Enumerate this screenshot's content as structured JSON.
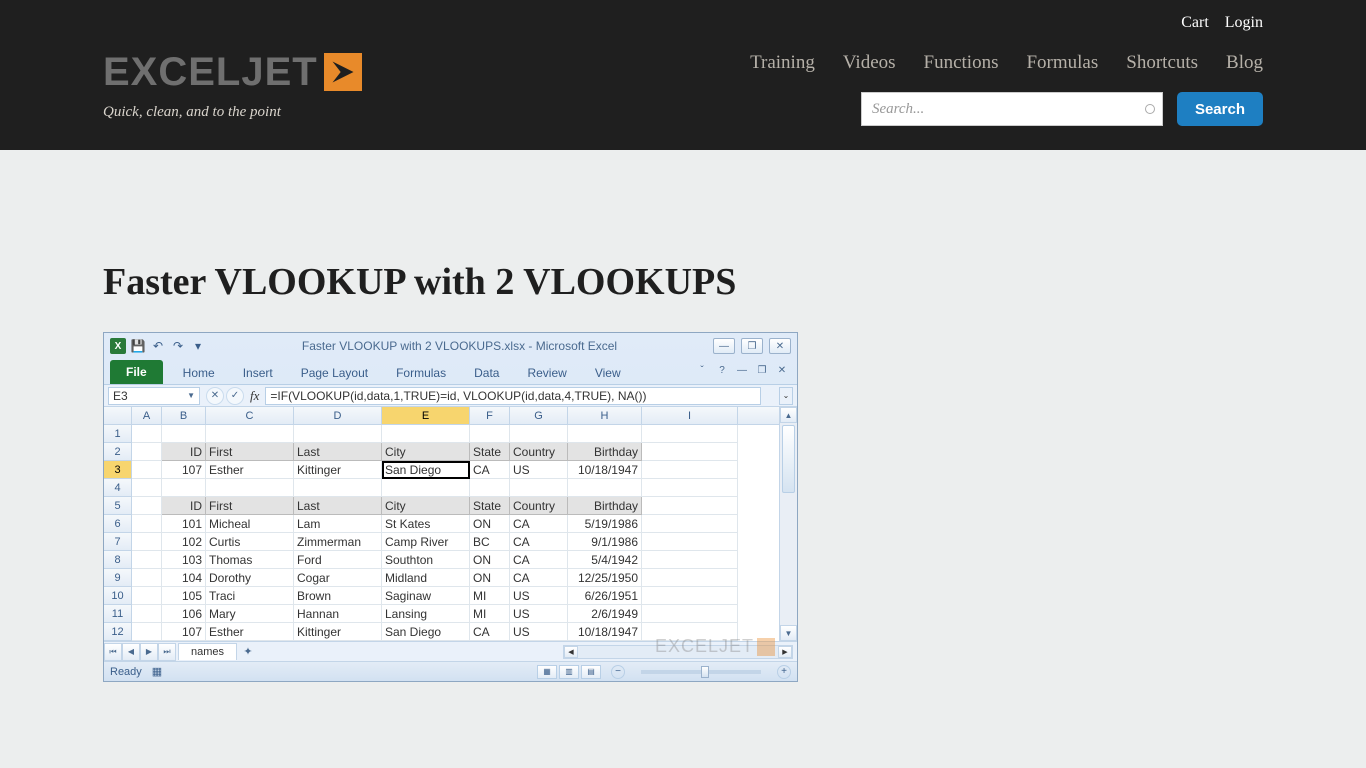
{
  "topnav": {
    "cart": "Cart",
    "login": "Login"
  },
  "brand": {
    "name": "EXCELJET",
    "tagline": "Quick, clean, and to the point"
  },
  "nav": [
    "Training",
    "Videos",
    "Functions",
    "Formulas",
    "Shortcuts",
    "Blog"
  ],
  "search": {
    "placeholder": "Search...",
    "button": "Search"
  },
  "page": {
    "title": "Faster VLOOKUP with 2 VLOOKUPS"
  },
  "excel": {
    "doc_title": "Faster VLOOKUP with 2 VLOOKUPS.xlsx  -  Microsoft Excel",
    "tabs": [
      "File",
      "Home",
      "Insert",
      "Page Layout",
      "Formulas",
      "Data",
      "Review",
      "View"
    ],
    "name_box": "E3",
    "fx_label": "fx",
    "formula": "=IF(VLOOKUP(id,data,1,TRUE)=id, VLOOKUP(id,data,4,TRUE), NA())",
    "col_widths": {
      "A": 30,
      "B": 44,
      "C": 88,
      "D": 88,
      "E": 88,
      "F": 40,
      "G": 58,
      "H": 74,
      "I": 96
    },
    "columns": [
      "A",
      "B",
      "C",
      "D",
      "E",
      "F",
      "G",
      "H",
      "I"
    ],
    "headers_row2": {
      "B": "ID",
      "C": "First",
      "D": "Last",
      "E": "City",
      "F": "State",
      "G": "Country",
      "H": "Birthday"
    },
    "result_row3": {
      "B": "107",
      "C": "Esther",
      "D": "Kittinger",
      "E": "San Diego",
      "F": "CA",
      "G": "US",
      "H": "10/18/1947"
    },
    "headers_row5": {
      "B": "ID",
      "C": "First",
      "D": "Last",
      "E": "City",
      "F": "State",
      "G": "Country",
      "H": "Birthday"
    },
    "data_rows": [
      {
        "row": 6,
        "B": "101",
        "C": "Micheal",
        "D": "Lam",
        "E": "St Kates",
        "F": "ON",
        "G": "CA",
        "H": "5/19/1986"
      },
      {
        "row": 7,
        "B": "102",
        "C": "Curtis",
        "D": "Zimmerman",
        "E": "Camp River",
        "F": "BC",
        "G": "CA",
        "H": "9/1/1986"
      },
      {
        "row": 8,
        "B": "103",
        "C": "Thomas",
        "D": "Ford",
        "E": "Southton",
        "F": "ON",
        "G": "CA",
        "H": "5/4/1942"
      },
      {
        "row": 9,
        "B": "104",
        "C": "Dorothy",
        "D": "Cogar",
        "E": "Midland",
        "F": "ON",
        "G": "CA",
        "H": "12/25/1950"
      },
      {
        "row": 10,
        "B": "105",
        "C": "Traci",
        "D": "Brown",
        "E": "Saginaw",
        "F": "MI",
        "G": "US",
        "H": "6/26/1951"
      },
      {
        "row": 11,
        "B": "106",
        "C": "Mary",
        "D": "Hannan",
        "E": "Lansing",
        "F": "MI",
        "G": "US",
        "H": "2/6/1949"
      },
      {
        "row": 12,
        "B": "107",
        "C": "Esther",
        "D": "Kittinger",
        "E": "San Diego",
        "F": "CA",
        "G": "US",
        "H": "10/18/1947"
      }
    ],
    "sheet_tab": "names",
    "status": "Ready",
    "watermark": "EXCELJET"
  }
}
